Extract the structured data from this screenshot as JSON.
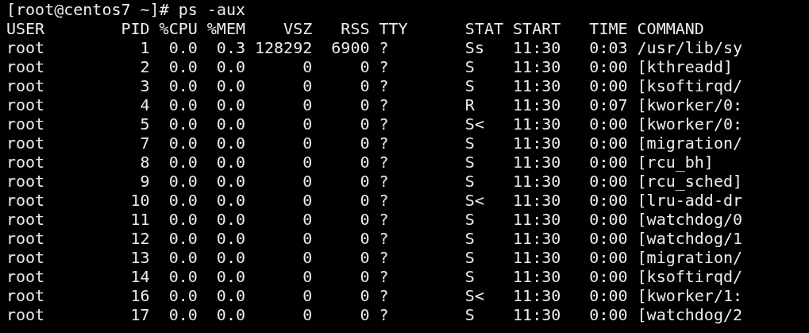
{
  "terminal": {
    "prompt": "[root@centos7 ~]# ps -aux",
    "columns": [
      "USER",
      "PID",
      "%CPU",
      "%MEM",
      "VSZ",
      "RSS",
      "TTY",
      "STAT",
      "START",
      "TIME",
      "COMMAND"
    ],
    "rows": [
      [
        "root",
        "1",
        "0.0",
        "0.3",
        "128292",
        "6900",
        "?",
        "Ss",
        "11:30",
        "0:03",
        "/usr/lib/sy"
      ],
      [
        "root",
        "2",
        "0.0",
        "0.0",
        "0",
        "0",
        "?",
        "S",
        "11:30",
        "0:00",
        "[kthreadd]"
      ],
      [
        "root",
        "3",
        "0.0",
        "0.0",
        "0",
        "0",
        "?",
        "S",
        "11:30",
        "0:00",
        "[ksoftirqd/"
      ],
      [
        "root",
        "4",
        "0.0",
        "0.0",
        "0",
        "0",
        "?",
        "R",
        "11:30",
        "0:07",
        "[kworker/0:"
      ],
      [
        "root",
        "5",
        "0.0",
        "0.0",
        "0",
        "0",
        "?",
        "S<",
        "11:30",
        "0:00",
        "[kworker/0:"
      ],
      [
        "root",
        "7",
        "0.0",
        "0.0",
        "0",
        "0",
        "?",
        "S",
        "11:30",
        "0:00",
        "[migration/"
      ],
      [
        "root",
        "8",
        "0.0",
        "0.0",
        "0",
        "0",
        "?",
        "S",
        "11:30",
        "0:00",
        "[rcu_bh]"
      ],
      [
        "root",
        "9",
        "0.0",
        "0.0",
        "0",
        "0",
        "?",
        "S",
        "11:30",
        "0:00",
        "[rcu_sched]"
      ],
      [
        "root",
        "10",
        "0.0",
        "0.0",
        "0",
        "0",
        "?",
        "S<",
        "11:30",
        "0:00",
        "[lru-add-dr"
      ],
      [
        "root",
        "11",
        "0.0",
        "0.0",
        "0",
        "0",
        "?",
        "S",
        "11:30",
        "0:00",
        "[watchdog/0"
      ],
      [
        "root",
        "12",
        "0.0",
        "0.0",
        "0",
        "0",
        "?",
        "S",
        "11:30",
        "0:00",
        "[watchdog/1"
      ],
      [
        "root",
        "13",
        "0.0",
        "0.0",
        "0",
        "0",
        "?",
        "S",
        "11:30",
        "0:00",
        "[migration/"
      ],
      [
        "root",
        "14",
        "0.0",
        "0.0",
        "0",
        "0",
        "?",
        "S",
        "11:30",
        "0:00",
        "[ksoftirqd/"
      ],
      [
        "root",
        "16",
        "0.0",
        "0.0",
        "0",
        "0",
        "?",
        "S<",
        "11:30",
        "0:00",
        "[kworker/1:"
      ],
      [
        "root",
        "17",
        "0.0",
        "0.0",
        "0",
        "0",
        "?",
        "S",
        "11:30",
        "0:00",
        "[watchdog/2"
      ]
    ]
  }
}
